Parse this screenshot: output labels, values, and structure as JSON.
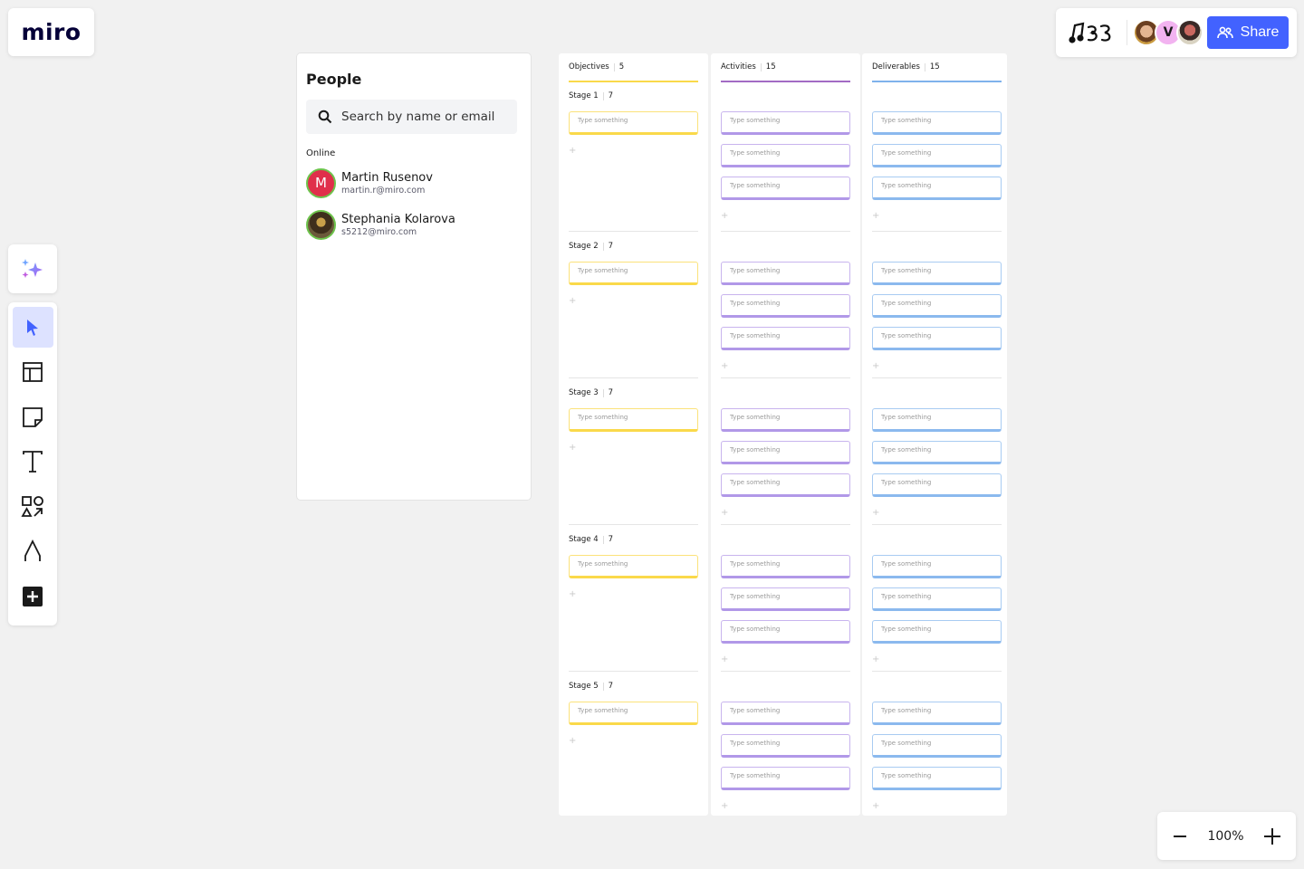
{
  "app": {
    "logo": "miro"
  },
  "topbar": {
    "board_icon": "board-doodle-icon",
    "avatars": [
      {
        "name": "collaborator-1",
        "initial": ""
      },
      {
        "name": "collaborator-v",
        "initial": "V"
      },
      {
        "name": "collaborator-3",
        "initial": ""
      }
    ],
    "share_label": "Share"
  },
  "toolbar": {
    "ai_icon": "sparkles-icon",
    "tools": [
      {
        "name": "select-tool",
        "icon": "cursor-icon",
        "active": true
      },
      {
        "name": "templates-tool",
        "icon": "layout-icon",
        "active": false
      },
      {
        "name": "sticky-note-tool",
        "icon": "sticky-note-icon",
        "active": false
      },
      {
        "name": "text-tool",
        "icon": "text-icon",
        "active": false
      },
      {
        "name": "shapes-tool",
        "icon": "shapes-icon",
        "active": false
      },
      {
        "name": "pen-tool",
        "icon": "pen-icon",
        "active": false
      },
      {
        "name": "more-tools",
        "icon": "plus-square-icon",
        "active": false
      }
    ]
  },
  "zoom": {
    "level": "100%",
    "minus": "zoom-out",
    "plus": "zoom-in"
  },
  "people": {
    "title": "People",
    "search_placeholder": "Search by name or email",
    "online_label": "Online",
    "users": [
      {
        "name": "Martin Rusenov",
        "email": "martin.r@miro.com",
        "initial": "M"
      },
      {
        "name": "Stephania Kolarova",
        "email": "s5212@miro.com",
        "initial": ""
      }
    ]
  },
  "board": {
    "columns": [
      {
        "title": "Objectives",
        "count": "5",
        "color": "#fad94a"
      },
      {
        "title": "Activities",
        "count": "15",
        "color": "#a26bc4"
      },
      {
        "title": "Deliverables",
        "count": "15",
        "color": "#7fb2ec"
      }
    ],
    "stages": [
      {
        "label": "Stage 1",
        "count": "7"
      },
      {
        "label": "Stage 2",
        "count": "7"
      },
      {
        "label": "Stage 3",
        "count": "7"
      },
      {
        "label": "Stage 4",
        "count": "7"
      },
      {
        "label": "Stage 5",
        "count": "7"
      }
    ],
    "card_placeholder": "Type something",
    "add_symbol": "+"
  }
}
